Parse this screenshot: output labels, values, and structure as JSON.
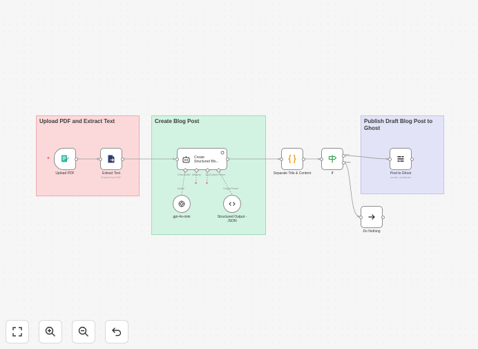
{
  "groups": [
    {
      "title": "Upload PDF and Extract Text",
      "color": "#fbd9db",
      "border": "#f1a8ad"
    },
    {
      "title": "Create Blog Post",
      "color": "#d3f3e2",
      "border": "#9fdbbb"
    },
    {
      "title": "Publish Draft Blog Post to Ghost",
      "color": "#e3e3f8",
      "border": "#c2c2ec"
    }
  ],
  "nodes": {
    "upload_pdf": {
      "label": "Upload PDF"
    },
    "extract_text": {
      "label": "Extract Text",
      "sublabel": "Extract from PDF"
    },
    "create_post": {
      "label_line1": "Create",
      "label_line2": "Structured Blo..."
    },
    "gpt": {
      "label": "gpt-4o-mini"
    },
    "structured_output": {
      "label_line1": "Structured Output -",
      "label_line2": "JSON"
    },
    "separate": {
      "label": "Separate Title & Content"
    },
    "if_node": {
      "label": "If"
    },
    "post_ghost": {
      "label": "Post to Ghost",
      "sublabel": "create: undefined"
    },
    "do_nothing": {
      "label": "Do Nothing"
    }
  },
  "port_labels": {
    "chat_model": "Chat Model",
    "memory": "Memory",
    "tool": "Tool",
    "output_parser": "Output Parser",
    "model_link": "Model",
    "parser_link": "Output Parser",
    "if_true": "true",
    "if_false": "false"
  },
  "toolbar": [
    "fit-view",
    "zoom-in",
    "zoom-out",
    "undo"
  ],
  "colors": {
    "edge": "#9a9a9a",
    "accent_pink": "#e06b6b",
    "icon_teal": "#2bb6a3",
    "icon_navy": "#2f3a6b",
    "icon_orange": "#f39c12",
    "icon_green": "#33a852"
  }
}
